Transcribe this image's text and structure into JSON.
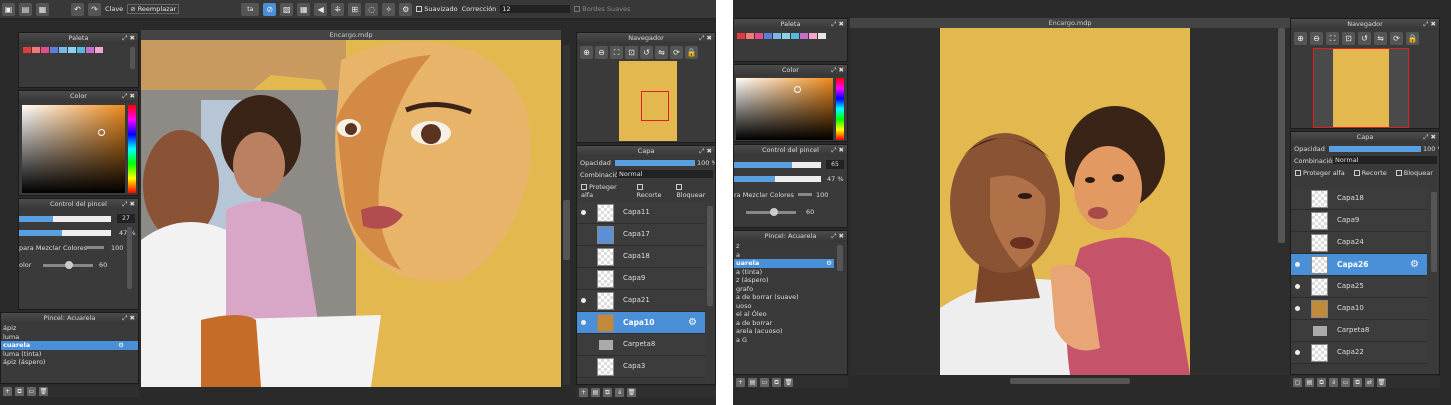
{
  "left": {
    "toolbar": {
      "clave_label": "Clave",
      "reemplazar_label": "Reemplazar",
      "suavizado_label": "Suavizado",
      "correccion_label": "Corrección",
      "correccion_value": "12",
      "bordes_label": "Bordes Suaves"
    },
    "canvas_title": "Encargo.mdp",
    "paleta": {
      "title": "Paleta"
    },
    "color": {
      "title": "Color"
    },
    "brush_control": {
      "title": "Control del pincel",
      "size_value": "27",
      "opacity_value": "47 %",
      "mix_label": "para Mezclar Colores",
      "mix_value": "100",
      "color_label": "olor",
      "color_value": "60"
    },
    "brush_list": {
      "title": "Pincel: Acuarela",
      "items": [
        "ápiz",
        "luma",
        "cuarela",
        "luma (tinta)",
        "ápiz (áspero)"
      ],
      "selected_index": 2
    },
    "navigator": {
      "title": "Navegador"
    },
    "layers": {
      "title": "Capa",
      "opacity_label": "Opacidad",
      "opacity_value": "100 %",
      "blend_label": "Combinación",
      "blend_value": "Normal",
      "protect_alpha": "Proteger alfa",
      "clip": "Recorte",
      "lock": "Bloquear",
      "rows": [
        {
          "name": "Capa11",
          "visible": true
        },
        {
          "name": "Capa17",
          "visible": false
        },
        {
          "name": "Capa18",
          "visible": false
        },
        {
          "name": "Capa9",
          "visible": false
        },
        {
          "name": "Capa21",
          "visible": true
        },
        {
          "name": "Capa10",
          "visible": true,
          "selected": true
        },
        {
          "name": "Carpeta8",
          "visible": false,
          "folder": true
        },
        {
          "name": "Capa3",
          "visible": false
        }
      ]
    }
  },
  "right": {
    "canvas_title": "Encargo.mdp",
    "paleta": {
      "title": "Paleta"
    },
    "color": {
      "title": "Color"
    },
    "brush_control": {
      "title": "Control del pincel",
      "size_value": "65",
      "opacity_value": "47 %",
      "mix_label": "ra Mezclar Colores",
      "mix_value": "100",
      "color_value": "60"
    },
    "brush_list": {
      "title": "Pincel: Acuarela",
      "items": [
        "z",
        "a",
        "uarela",
        "a (tinta)",
        "z (áspero)",
        "grafo",
        "a de borrar (suave)",
        "uoso",
        "el al Óleo",
        "a de borrar",
        "arela (acuoso)",
        "a G"
      ],
      "selected_index": 2
    },
    "navigator": {
      "title": "Navegador"
    },
    "layers": {
      "title": "Capa",
      "opacity_label": "Opacidad",
      "opacity_value": "100 %",
      "blend_label": "Combinación",
      "blend_value": "Normal",
      "protect_alpha": "Proteger alfa",
      "clip": "Recorte",
      "lock": "Bloquear",
      "rows": [
        {
          "name": "Capa18",
          "visible": false
        },
        {
          "name": "Capa9",
          "visible": false
        },
        {
          "name": "Capa24",
          "visible": false
        },
        {
          "name": "Capa26",
          "visible": true,
          "selected": true
        },
        {
          "name": "Capa25",
          "visible": true
        },
        {
          "name": "Capa10",
          "visible": true
        },
        {
          "name": "Carpeta8",
          "visible": false,
          "folder": true
        },
        {
          "name": "Capa22",
          "visible": true
        }
      ]
    }
  },
  "colors": {
    "canvas_bg": "#e3b84e",
    "accent": "#4a90d9",
    "panel": "#3a3a3a"
  },
  "palette_swatches": [
    "#e33b3b",
    "#f07a7a",
    "#e04f8a",
    "#5b7fd6",
    "#7ab6e6",
    "#8fd0e8",
    "#54b8e0",
    "#c46fc8",
    "#f1a6d0",
    "#e6e6e6",
    "#aaaaaa"
  ]
}
